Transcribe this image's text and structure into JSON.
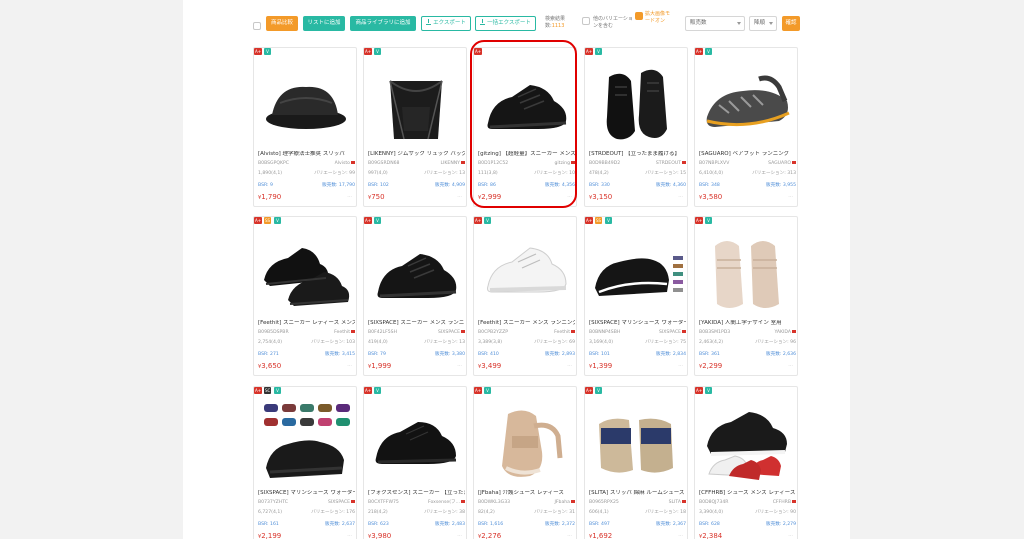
{
  "toolbar": {
    "buttons": [
      {
        "label": "商品比較",
        "style": "orange"
      },
      {
        "label": "リストに追加",
        "style": "teal"
      },
      {
        "label": "商品ライブラリに追加",
        "style": "teal"
      },
      {
        "label": "エクスポート",
        "style": "outline"
      },
      {
        "label": "一括エクスポート",
        "style": "outline"
      }
    ],
    "search_results_label": "検索結果数:",
    "search_results_count": "1113",
    "variation_option": "他のバリエーションを含む",
    "expanded_mode_option": "拡大画像モードオン",
    "sort_select": "販売数",
    "order_select": "降順",
    "confirm_label": "確認"
  },
  "colors": {
    "accent_orange": "#f39a29",
    "teal": "#29b9a3",
    "price_red": "#d8332a",
    "link_blue": "#4f8ed8",
    "highlight_red": "#e00000"
  },
  "products": [
    {
      "badges": [
        "A+",
        "V"
      ],
      "title": "[Alvisto] 理学療法士推奨 スリッパ",
      "asin": "B0BSGPQKPC",
      "brand": "Alvisto",
      "rating": "1,890(4,1)",
      "variations": "バリエーション: 99",
      "bsr": "BSR: 9",
      "sales": "販売数: 17,790",
      "price": "1,790",
      "image": "slipper"
    },
    {
      "badges": [
        "A+",
        "V"
      ],
      "title": "[LIKENNY] ジムサック リュック バッグ",
      "asin": "B09GSRDN68",
      "brand": "LIKENNY",
      "rating": "997(4,0)",
      "variations": "バリエーション: 13",
      "bsr": "BSR: 102",
      "sales": "販売数: 4,909",
      "price": "750",
      "image": "bag"
    },
    {
      "badges": [
        "A+"
      ],
      "title": "[gitzing] 【超軽量】スニーカー メンズ",
      "asin": "B0D1P12C52",
      "brand": "gitzing",
      "rating": "111(3,8)",
      "variations": "バリエーション: 10",
      "bsr": "BSR: 86",
      "sales": "販売数: 4,356",
      "price": "2,999",
      "image": "black-sneaker"
    },
    {
      "badges": [
        "A+",
        "V"
      ],
      "title": "[STRDEOUT] 【立ったまま履ける】",
      "asin": "B0D9BB49D2",
      "brand": "STRDEOUT",
      "rating": "478(4,2)",
      "variations": "バリエーション: 15",
      "bsr": "BSR: 330",
      "sales": "販売数: 4,360",
      "price": "3,150",
      "image": "black-shoe-pair"
    },
    {
      "badges": [
        "A+",
        "V"
      ],
      "title": "[SAGUARO] ベアフット ランニング",
      "asin": "B07NBPLXVV",
      "brand": "SAGUARO",
      "rating": "6,410(4,0)",
      "variations": "バリエーション: 313",
      "bsr": "BSR: 348",
      "sales": "販売数: 3,955",
      "price": "3,580",
      "image": "barefoot"
    },
    {
      "badges": [
        "A+",
        "SS",
        "V"
      ],
      "title": "[Feethit] スニーカー レディース メンズ",
      "asin": "B09B5DSPBR",
      "brand": "Feethit",
      "rating": "2,754(4,0)",
      "variations": "バリエーション: 103",
      "bsr": "BSR: 271",
      "sales": "販売数: 3,415",
      "price": "3,650",
      "image": "black-knit-pair"
    },
    {
      "badges": [
        "A+",
        "V"
      ],
      "title": "[SIXSPACE] スニーカー メンズ ランニング",
      "asin": "B0F42LF5SH",
      "brand": "SIXSPACE",
      "rating": "419(4,0)",
      "variations": "バリエーション: 13",
      "bsr": "BSR: 79",
      "sales": "販売数: 3,380",
      "price": "1,999",
      "image": "black-sneaker"
    },
    {
      "badges": [
        "A+",
        "V"
      ],
      "title": "[Feethit] スニーカー メンズ ランニング",
      "asin": "B0CPB2YZZP",
      "brand": "Feethit",
      "rating": "3,389(3,8)",
      "variations": "バリエーション: 69",
      "bsr": "BSR: 410",
      "sales": "販売数: 2,893",
      "price": "3,499",
      "image": "white-sneaker"
    },
    {
      "badges": [
        "A+",
        "SS",
        "V"
      ],
      "title": "[SIXSPACE] マリンシューズ ウォーター",
      "asin": "B0BNNP4SBH",
      "brand": "SIXSPACE",
      "rating": "3,169(4,0)",
      "variations": "バリエーション: 75",
      "bsr": "BSR: 101",
      "sales": "販売数: 2,834",
      "price": "1,399",
      "image": "water-shoe"
    },
    {
      "badges": [
        "A+",
        "V"
      ],
      "title": "[YAKIDA] 人間工学デザイン 室用",
      "asin": "B0B3SM1PD3",
      "brand": "YAKIDA",
      "rating": "2,463(4,2)",
      "variations": "バリエーション: 96",
      "bsr": "BSR: 361",
      "sales": "販売数: 2,636",
      "price": "2,299",
      "image": "beige-slipper"
    },
    {
      "badges": [
        "A+",
        "SC",
        "V"
      ],
      "title": "[SIXSPACE] マリンシューズ ウォーター",
      "asin": "B0737YZHTC",
      "brand": "SIXSPACE",
      "rating": "6,727(4,1)",
      "variations": "バリエーション: 176",
      "bsr": "BSR: 161",
      "sales": "販売数: 2,637",
      "price": "2,199",
      "image": "water-shoes-multi"
    },
    {
      "badges": [
        "A+",
        "V"
      ],
      "title": "[フォクスセンス] スニーカー 【立ったまま】",
      "asin": "B0CXTFFW75",
      "brand": "Foxsense(フ...",
      "rating": "218(4,2)",
      "variations": "バリエーション: 38",
      "bsr": "BSR: 623",
      "sales": "販売数: 2,483",
      "price": "3,980",
      "image": "leather-sneaker"
    },
    {
      "badges": [
        "A+",
        "V"
      ],
      "title": "[JFbaha] 介護シューズ レディース",
      "asin": "B0DWKL3G33",
      "brand": "JFbaha",
      "rating": "82(4,2)",
      "variations": "バリエーション: 31",
      "bsr": "BSR: 1,616",
      "sales": "販売数: 2,372",
      "price": "2,276",
      "image": "care-shoe"
    },
    {
      "badges": [
        "A+",
        "V"
      ],
      "title": "[SLITA] スリッパ 綿麻 ルームシューズ",
      "asin": "B0965RPX25",
      "brand": "SLITA",
      "rating": "606(4,1)",
      "variations": "バリエーション: 18",
      "bsr": "BSR: 497",
      "sales": "販売数: 2,367",
      "price": "1,692",
      "image": "navy-slipper"
    },
    {
      "badges": [
        "A+",
        "V"
      ],
      "title": "[CFFHRB] シューズ メンズ レディース",
      "asin": "B0D8QJ734R",
      "brand": "CFFHRB",
      "rating": "3,390(4,0)",
      "variations": "バリエーション: 90",
      "bsr": "BSR: 628",
      "sales": "販売数: 2,279",
      "price": "2,384",
      "image": "air-sneaker"
    }
  ]
}
